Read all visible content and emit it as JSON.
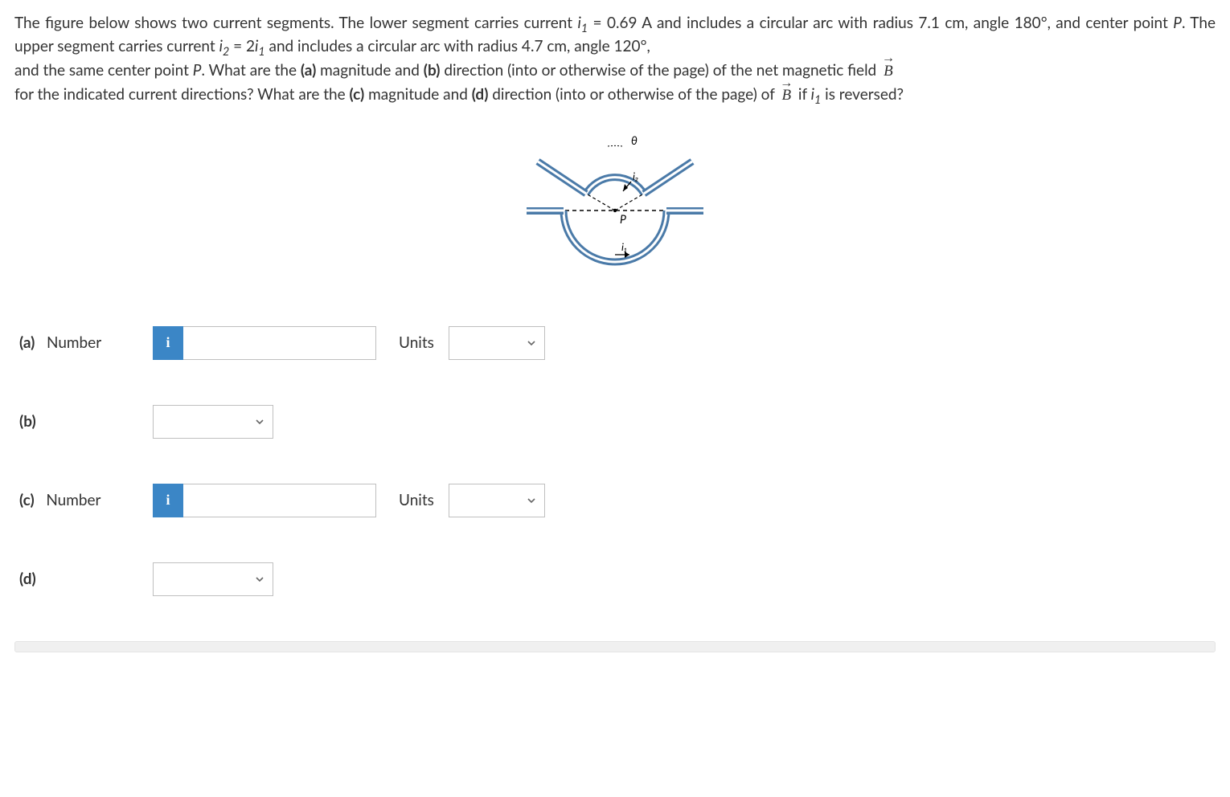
{
  "question": {
    "p1_segA": "The figure below shows two current segments. The lower segment carries current ",
    "i1_sym": "i",
    "i1_sub": "1",
    "eq1": " = 0.69 A and includes a circular arc with radius 7.1 cm, angle 180°, and center point ",
    "P1": "P",
    "p1_tail": ". The upper segment carries current ",
    "i2_sym": "i",
    "i2_sub": "2",
    "eq2": " = 2",
    "i1b_sym": "i",
    "i1b_sub": "1",
    "p1_end": " and includes a circular arc with radius 4.7 cm, angle 120°,",
    "p2_segA": "and the same center point ",
    "P2": "P",
    "p2_segB": ". What are the ",
    "a_label": "(a)",
    "p2_segC": " magnitude and ",
    "b_label": "(b)",
    "p2_segD": " direction (into or otherwise of the page) of the net magnetic field  ",
    "B1": "B",
    "p3_segA": "for the indicated current directions? What are the ",
    "c_label": "(c)",
    "p3_segB": " magnitude and ",
    "d_label": "(d)",
    "p3_segC": " direction (into or otherwise of the page) of  ",
    "B2": "B",
    "p3_segD": "  if ",
    "i1c_sym": "i",
    "i1c_sub": "1",
    "p3_end": " is reversed?"
  },
  "figure_labels": {
    "theta": "θ",
    "i2": "i₂",
    "P": "P",
    "i1": "i₁"
  },
  "answers": {
    "a": {
      "part": "(a)",
      "type_label": "Number",
      "info": "i",
      "value": "",
      "units_label": "Units",
      "units_value": ""
    },
    "b": {
      "part": "(b)",
      "value": ""
    },
    "c": {
      "part": "(c)",
      "type_label": "Number",
      "info": "i",
      "value": "",
      "units_label": "Units",
      "units_value": ""
    },
    "d": {
      "part": "(d)",
      "value": ""
    }
  }
}
